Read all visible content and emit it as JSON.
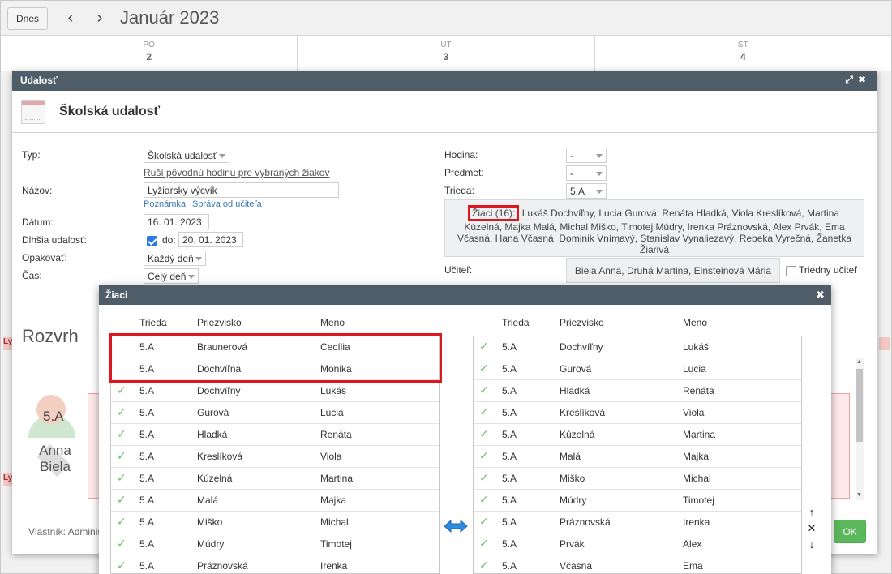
{
  "calendar": {
    "today_label": "Dnes",
    "title": "Január 2023",
    "days": [
      {
        "name": "PO",
        "date": "2"
      },
      {
        "name": "UT",
        "date": "3"
      },
      {
        "name": "ST",
        "date": "4"
      }
    ],
    "side_tab_label": "Ly"
  },
  "event_dialog": {
    "header": "Udalosť",
    "title": "Školská udalosť",
    "labels": {
      "typ": "Typ:",
      "nazov": "Názov:",
      "datum": "Dátum:",
      "dlhsia": "Dlhšia udalosť:",
      "opakovat": "Opakovať:",
      "cas": "Čas:",
      "hodina": "Hodina:",
      "predmet": "Predmet:",
      "trieda": "Trieda:",
      "ucitel": "Učiteľ:",
      "do": "do:"
    },
    "values": {
      "typ": "Školská udalosť",
      "rusi_link": "Ruší pôvodnú hodinu pre vybraných žiakov",
      "nazov": "Lyžiarsky výcvik",
      "poznamka": "Poznámka",
      "sprava": "Správa od učiteľa",
      "datum": "16. 01. 2023",
      "datum_do": "20. 01. 2023",
      "opakovat": "Každý deň",
      "cas": "Celý deň",
      "hodina": "-",
      "predmet": "-",
      "trieda": "5.A",
      "students_count": "Žiaci (16):",
      "students_list": "Lukáš Dochvíľny, Lucia Gurová, Renáta Hladká, Viola Kreslíková, Martina Kúzelná, Majka Malá, Michal Miško, Timotej Múdry, Irenka Práznovská, Alex Prvák, Ema Včasná, Hana Včasná, Dominik Vnímavý, Stanislav Vynaliezavý, Rebeka Vyrečná, Žanetka Žiarivá",
      "ucitelia": "Biela Anna, Druhá Martina, Einsteinová Mária",
      "triedny": "Triedny učiteľ"
    },
    "rozvrh": "Rozvrh",
    "avatar_class": "5.A",
    "avatar_name": "Anna Biela",
    "owner": "Vlastník: Adminis",
    "ok": "OK"
  },
  "students_dialog": {
    "header": "Žiaci",
    "columns": [
      "Trieda",
      "Priezvisko",
      "Meno"
    ],
    "left_rows": [
      {
        "checked": false,
        "trieda": "5.A",
        "priezvisko": "Braunerová",
        "meno": "Cecília"
      },
      {
        "checked": false,
        "trieda": "5.A",
        "priezvisko": "Dochvíľna",
        "meno": "Monika"
      },
      {
        "checked": true,
        "trieda": "5.A",
        "priezvisko": "Dochvíľny",
        "meno": "Lukáš"
      },
      {
        "checked": true,
        "trieda": "5.A",
        "priezvisko": "Gurová",
        "meno": "Lucia"
      },
      {
        "checked": true,
        "trieda": "5.A",
        "priezvisko": "Hladká",
        "meno": "Renáta"
      },
      {
        "checked": true,
        "trieda": "5.A",
        "priezvisko": "Kreslíková",
        "meno": "Viola"
      },
      {
        "checked": true,
        "trieda": "5.A",
        "priezvisko": "Kúzelná",
        "meno": "Martina"
      },
      {
        "checked": true,
        "trieda": "5.A",
        "priezvisko": "Malá",
        "meno": "Majka"
      },
      {
        "checked": true,
        "trieda": "5.A",
        "priezvisko": "Miško",
        "meno": "Michal"
      },
      {
        "checked": true,
        "trieda": "5.A",
        "priezvisko": "Múdry",
        "meno": "Timotej"
      },
      {
        "checked": true,
        "trieda": "5.A",
        "priezvisko": "Práznovská",
        "meno": "Irenka"
      }
    ],
    "right_rows": [
      {
        "trieda": "5.A",
        "priezvisko": "Dochvíľny",
        "meno": "Lukáš"
      },
      {
        "trieda": "5.A",
        "priezvisko": "Gurová",
        "meno": "Lucia"
      },
      {
        "trieda": "5.A",
        "priezvisko": "Hladká",
        "meno": "Renáta"
      },
      {
        "trieda": "5.A",
        "priezvisko": "Kreslíková",
        "meno": "Viola"
      },
      {
        "trieda": "5.A",
        "priezvisko": "Kúzelná",
        "meno": "Martina"
      },
      {
        "trieda": "5.A",
        "priezvisko": "Malá",
        "meno": "Majka"
      },
      {
        "trieda": "5.A",
        "priezvisko": "Miško",
        "meno": "Michal"
      },
      {
        "trieda": "5.A",
        "priezvisko": "Múdry",
        "meno": "Timotej"
      },
      {
        "trieda": "5.A",
        "priezvisko": "Práznovská",
        "meno": "Irenka"
      },
      {
        "trieda": "5.A",
        "priezvisko": "Prvák",
        "meno": "Alex"
      },
      {
        "trieda": "5.A",
        "priezvisko": "Včasná",
        "meno": "Ema"
      }
    ]
  },
  "colors": {
    "header_bg": "#4e5d68",
    "highlight_red": "#e0161e",
    "check_green": "#6cbf6c",
    "ok_green": "#5cb85c",
    "link_blue": "#3a7ab5"
  }
}
